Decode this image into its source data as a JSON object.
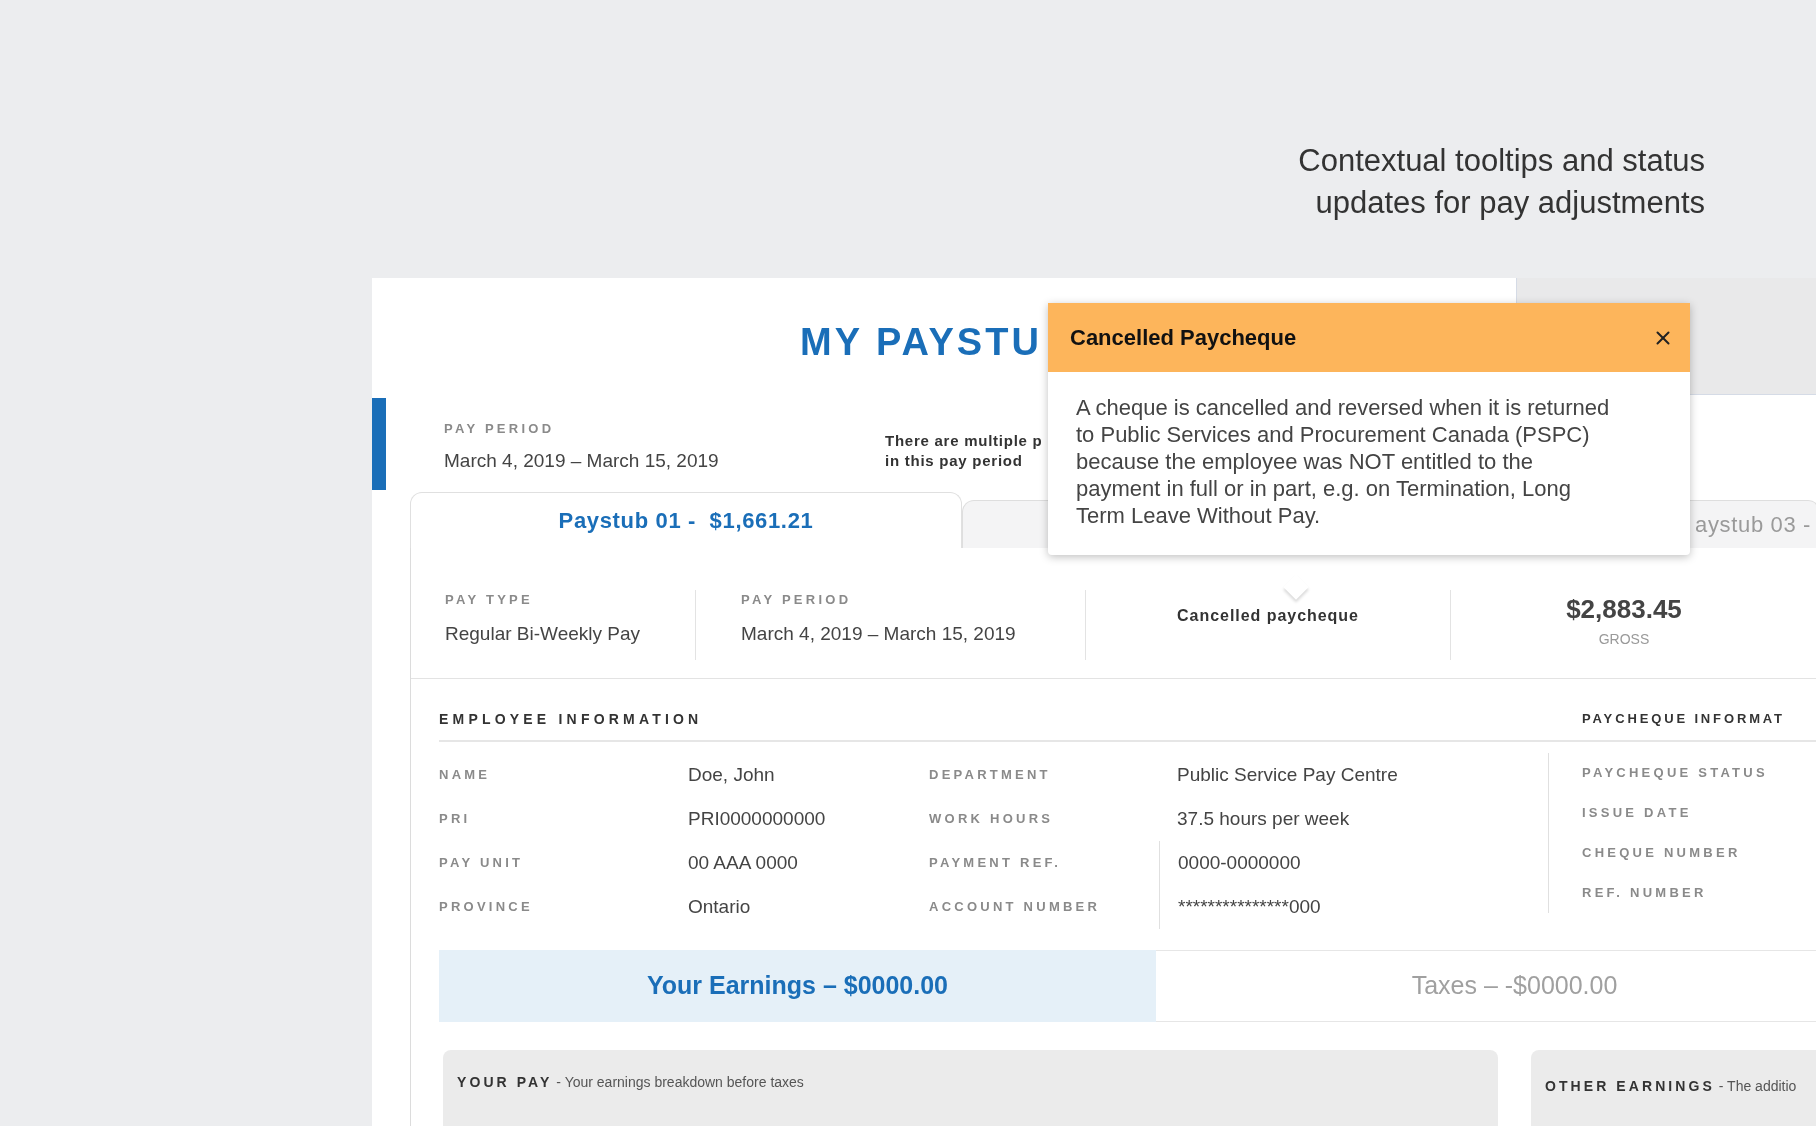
{
  "headline": "Contextual tooltips and status updates for pay adjustments",
  "paystub": {
    "title": "MY PAYSTU",
    "pay_period": {
      "label": "PAY PERIOD",
      "value": "March 4, 2019 – March 15, 2019"
    },
    "notice_lines": [
      "There are multiple p",
      "in this pay period"
    ],
    "tabs": [
      {
        "label": "Paystub 01 -  $1,661.21",
        "selected": true
      },
      {
        "selected": false
      },
      {
        "label": "aystub 03 -",
        "selected": false
      }
    ],
    "summary": [
      {
        "kind": "field",
        "label": "PAY TYPE",
        "value": "Regular Bi-Weekly Pay"
      },
      {
        "kind": "field",
        "label": "PAY PERIOD",
        "value": "March 4, 2019 – March 15, 2019"
      },
      {
        "kind": "status",
        "value": "Cancelled paycheque"
      },
      {
        "kind": "amount",
        "value": "$2,883.45",
        "label": "GROSS"
      }
    ],
    "employee_information": {
      "title": "EMPLOYEE INFORMATION",
      "rows": [
        {
          "label": "NAME",
          "value": "Doe, John",
          "label_2": "DEPARTMENT",
          "value_2": "Public Service Pay Centre"
        },
        {
          "label": "PRI",
          "value": "PRI0000000000",
          "label_2": "WORK HOURS",
          "value_2": "37.5 hours per week"
        },
        {
          "label": "PAY UNIT",
          "value": "00 AAA 0000",
          "label_2": "PAYMENT REF.",
          "value_2": "0000-0000000"
        },
        {
          "label": "PROVINCE",
          "value": "Ontario",
          "label_2": "ACCOUNT NUMBER",
          "value_2": "***************000"
        }
      ]
    },
    "paycheque_information": {
      "title": "PAYCHEQUE INFORMAT",
      "labels": [
        "PAYCHEQUE STATUS",
        "ISSUE DATE",
        "CHEQUE NUMBER",
        "REF. NUMBER"
      ]
    },
    "totals_tabs": [
      {
        "label": "Your Earnings – $0000.00",
        "selected": true
      },
      {
        "label": "Taxes – -$0000.00",
        "selected": false
      }
    ],
    "sections": [
      {
        "title": "YOUR PAY",
        "description": "- Your earnings breakdown before taxes"
      },
      {
        "title": "OTHER EARNINGS",
        "description": "- The additio"
      }
    ]
  },
  "tooltip": {
    "title": "Cancelled Paycheque",
    "body": "A cheque is cancelled and reversed when it is returned to Public Services and Procurement Canada (PSPC) because the employee was NOT entitled to the payment in full or in part, e.g. on Termination, Long Term Leave Without Pay."
  }
}
